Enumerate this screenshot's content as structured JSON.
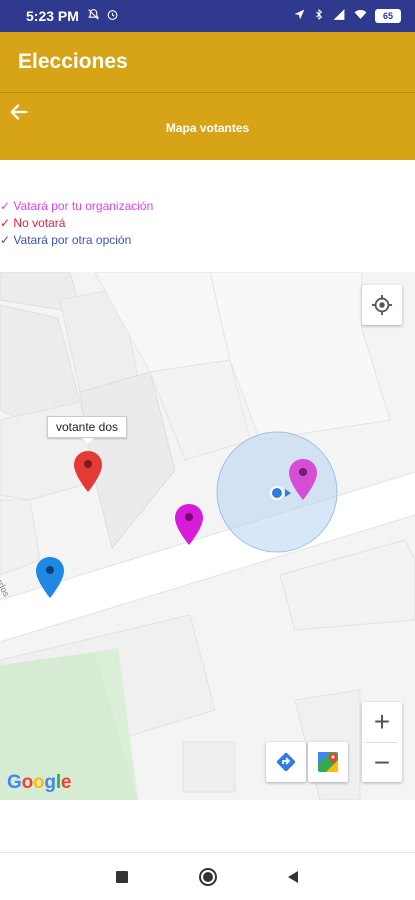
{
  "status_bar": {
    "time": "5:23 PM",
    "battery": "65"
  },
  "app_bar": {
    "title": "Elecciones"
  },
  "sub_bar": {
    "subtitle": "Mapa votantes"
  },
  "legend": {
    "items": [
      {
        "check": "✓",
        "label": "Vatará por tu organización",
        "color": "#e040fb"
      },
      {
        "check": "✓",
        "label": "No votará",
        "color": "#e91e3c"
      },
      {
        "check": "✓",
        "label": "Vatará por otra opción",
        "color": "#3f51b5"
      }
    ]
  },
  "map": {
    "tooltip": "votante dos",
    "street_label": "Cerdos",
    "google_logo": [
      "G",
      "o",
      "o",
      "g",
      "l",
      "e"
    ],
    "google_colors": [
      "#4285f4",
      "#ea4335",
      "#fbbc05",
      "#4285f4",
      "#34a853",
      "#ea4335"
    ],
    "markers": [
      {
        "name": "red",
        "color": "#e53935"
      },
      {
        "name": "magenta-road",
        "color": "#d81bd8"
      },
      {
        "name": "blue",
        "color": "#1e88e5"
      },
      {
        "name": "magenta-location",
        "color": "#d64ed6"
      }
    ],
    "zoom_in": "+",
    "zoom_out": "−"
  },
  "colors": {
    "status_bar": "#2f3a8f",
    "app_bar": "#d6a416",
    "park": "#d5ecd3",
    "location_circle": "#b7d3f0",
    "location_dot": "#2f7de1"
  },
  "icons": {
    "back": "arrow-left-icon",
    "locate": "my-location-icon",
    "directions": "directions-icon",
    "maps": "google-maps-icon",
    "nav_recents": "square-icon",
    "nav_home": "circle-icon",
    "nav_back": "triangle-icon"
  }
}
